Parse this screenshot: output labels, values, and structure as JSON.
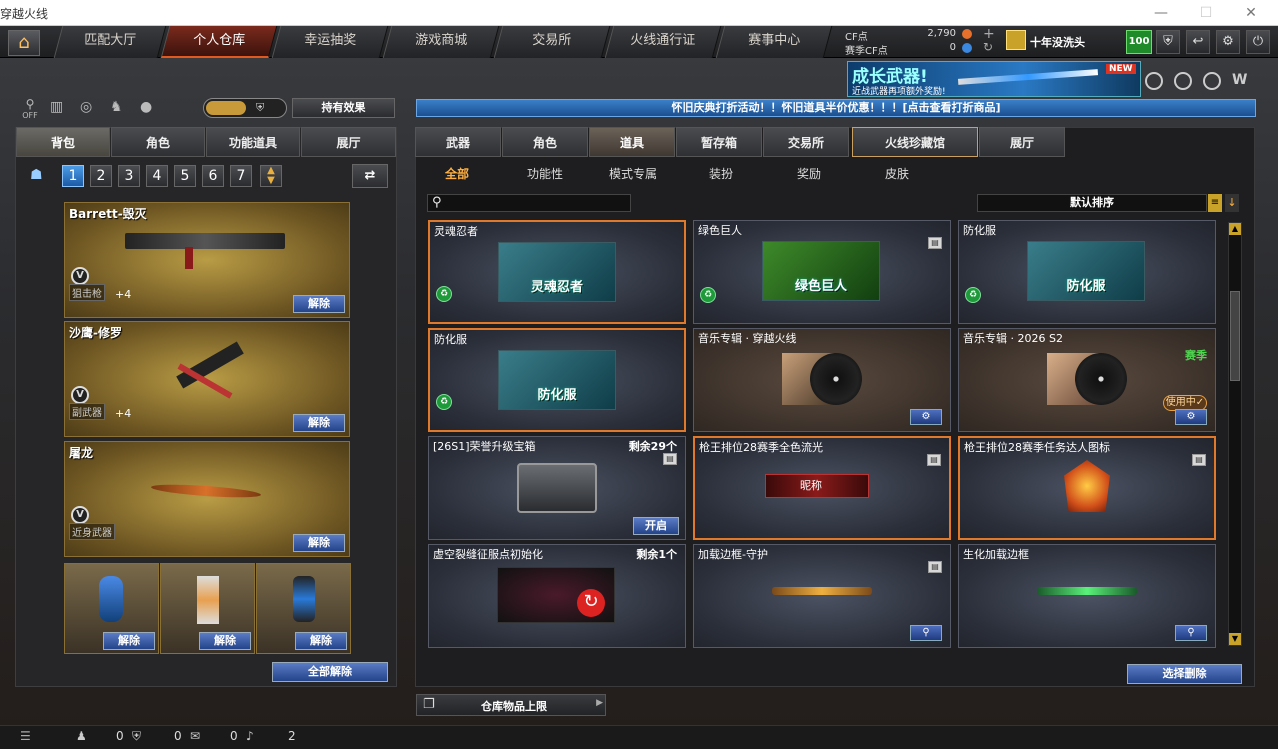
{
  "window": {
    "title": "穿越火线",
    "min_label": "—",
    "max_label": "☐",
    "close_label": "✕"
  },
  "nav": {
    "home_icon": "home-icon",
    "tabs": [
      {
        "label": "匹配大厅"
      },
      {
        "label": "个人仓库",
        "active": true
      },
      {
        "label": "幸运抽奖"
      },
      {
        "label": "游戏商城"
      },
      {
        "label": "交易所"
      },
      {
        "label": "火线通行证"
      },
      {
        "label": "赛事中心"
      }
    ],
    "cf_label": "CF点",
    "cf_value": "2,790",
    "season_cf_label": "赛季CF点",
    "season_cf_value": "0",
    "username": "十年没洗头",
    "level": "100"
  },
  "promo": {
    "title": "成长武器!",
    "subtitle": "近战武器再项额外奖励!",
    "badge": "NEW"
  },
  "announcement": "怀旧庆典打折活动！！怀旧道具半价优惠！！！[点击查看打折商品]",
  "left": {
    "toggle_off": "OFF",
    "effect_button": "持有效果",
    "tabs": [
      "背包",
      "角色",
      "功能道具",
      "展厅"
    ],
    "pages": [
      "1",
      "2",
      "3",
      "4",
      "5",
      "6",
      "7"
    ],
    "cards": [
      {
        "name": "Barrett-毁灭",
        "tag": "狙击枪",
        "level": "+4",
        "release": "解除"
      },
      {
        "name": "沙鹰-修罗",
        "tag": "副武器",
        "level": "+4",
        "release": "解除"
      },
      {
        "name": "屠龙",
        "tag": "近身武器",
        "release": "解除"
      }
    ],
    "grenades": [
      {
        "release": "解除"
      },
      {
        "release": "解除"
      },
      {
        "release": "解除"
      }
    ],
    "release_all": "全部解除",
    "v_badge": "V"
  },
  "right": {
    "tabs": [
      "武器",
      "角色",
      "道具",
      "暂存箱",
      "交易所",
      "火线珍藏馆",
      "展厅"
    ],
    "subtabs": [
      "全部",
      "功能性",
      "模式专属",
      "装扮",
      "奖励",
      "皮肤"
    ],
    "sort_label": "默认排序",
    "items": [
      {
        "name": "灵魂忍者",
        "pic_label": "灵魂忍者"
      },
      {
        "name": "绿色巨人",
        "pic_label": "绿色巨人"
      },
      {
        "name": "防化服",
        "pic_label": "防化服"
      },
      {
        "name": "防化服",
        "pic_label": "防化服"
      },
      {
        "name": "音乐专辑 · 穿越火线"
      },
      {
        "name": "音乐专辑 · 2026 S2",
        "season": "赛季",
        "inuse": "使用中✓"
      },
      {
        "name": "[26S1]荣誉升级宝箱",
        "remain": "剩余29个",
        "open": "开启"
      },
      {
        "name": "枪王排位28赛季全色流光",
        "nick": "昵称"
      },
      {
        "name": "枪王排位28赛季任务达人图标"
      },
      {
        "name": "虚空裂缝征服点初始化",
        "remain": "剩余1个"
      },
      {
        "name": "加载边框-守护"
      },
      {
        "name": "生化加载边框"
      }
    ],
    "delete_button": "选择删除",
    "storage_limit": "仓库物品上限"
  },
  "statusbar": {
    "v1": "0",
    "v2": "0",
    "v3": "0",
    "v4": "2"
  },
  "colors": {
    "accent": "#e05a20",
    "blue_button": "#23438a",
    "gold_card": "#b99c45",
    "season_green": "#4fd44f"
  }
}
